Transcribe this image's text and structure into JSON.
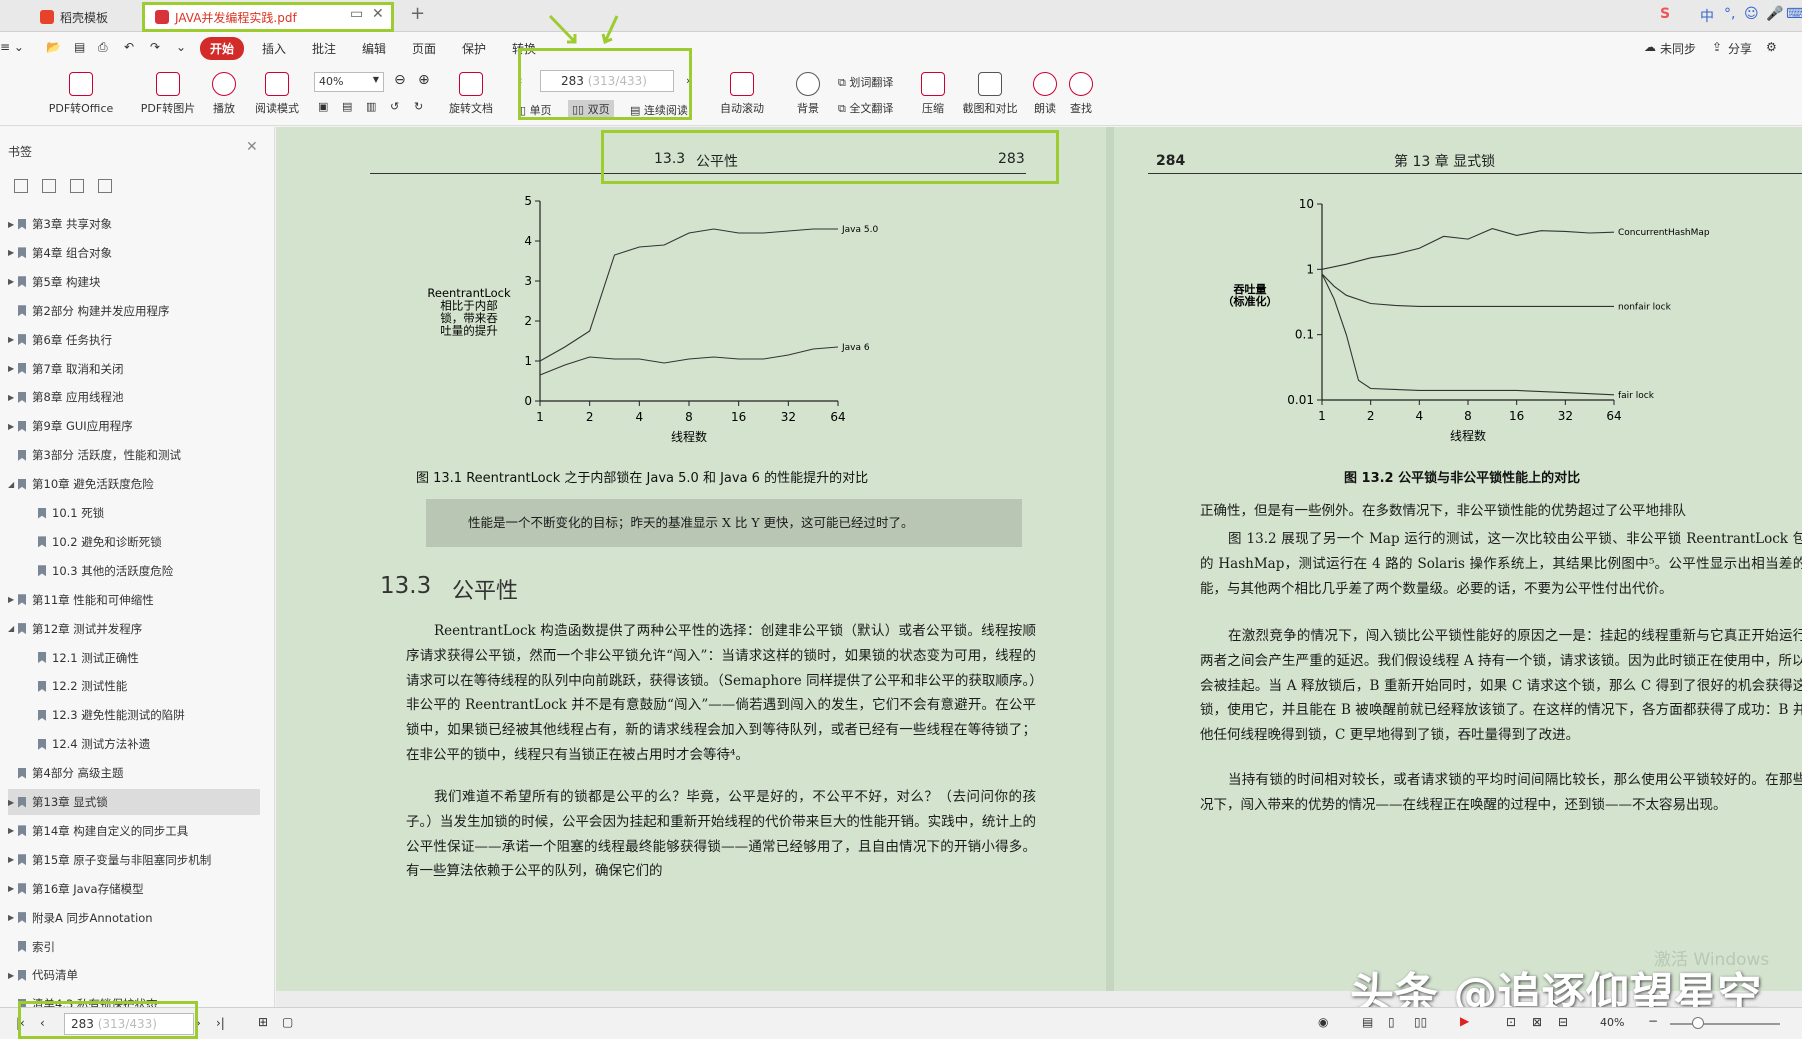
{
  "tabs": [
    {
      "label": "稻壳模板"
    },
    {
      "label": "JAVA并发编程实践.pdf"
    }
  ],
  "menu": [
    "开始",
    "插入",
    "批注",
    "编辑",
    "页面",
    "保护",
    "转换"
  ],
  "topright": {
    "sync": "未同步",
    "share": "分享"
  },
  "ribbon": {
    "pdf_office": "PDF转Office",
    "pdf_image": "PDF转图片",
    "play": "播放",
    "read_mode": "阅读模式",
    "zoom": "40%",
    "rotate": "旋转文档",
    "page_current": "283",
    "page_total": "(313/433)",
    "single": "单页",
    "double": "双页",
    "continuous": "连续阅读",
    "autoscroll": "自动滚动",
    "background": "背景",
    "word_translate": "划词翻译",
    "full_translate": "全文翻译",
    "compress": "压缩",
    "screenshot": "截图和对比",
    "read_aloud": "朗读",
    "find": "查找"
  },
  "sidebar": {
    "title": "书签",
    "items": [
      {
        "label": "第3章  共享对象",
        "level": 0,
        "arrow": "▶"
      },
      {
        "label": "第4章  组合对象",
        "level": 0,
        "arrow": "▶"
      },
      {
        "label": "第5章  构建块",
        "level": 0,
        "arrow": "▶"
      },
      {
        "label": "第2部分  构建并发应用程序",
        "level": 0,
        "arrow": ""
      },
      {
        "label": "第6章  任务执行",
        "level": 0,
        "arrow": "▶"
      },
      {
        "label": "第7章  取消和关闭",
        "level": 0,
        "arrow": "▶"
      },
      {
        "label": "第8章  应用线程池",
        "level": 0,
        "arrow": "▶"
      },
      {
        "label": "第9章  GUI应用程序",
        "level": 0,
        "arrow": "▶"
      },
      {
        "label": "第3部分  活跃度，性能和测试",
        "level": 0,
        "arrow": ""
      },
      {
        "label": "第10章  避免活跃度危险",
        "level": 0,
        "arrow": "◢"
      },
      {
        "label": "10.1  死锁",
        "level": 1,
        "arrow": ""
      },
      {
        "label": "10.2  避免和诊断死锁",
        "level": 1,
        "arrow": ""
      },
      {
        "label": "10.3  其他的活跃度危险",
        "level": 1,
        "arrow": ""
      },
      {
        "label": "第11章  性能和可伸缩性",
        "level": 0,
        "arrow": "▶"
      },
      {
        "label": "第12章  测试并发程序",
        "level": 0,
        "arrow": "◢"
      },
      {
        "label": "12.1  测试正确性",
        "level": 1,
        "arrow": ""
      },
      {
        "label": "12.2  测试性能",
        "level": 1,
        "arrow": ""
      },
      {
        "label": "12.3  避免性能测试的陷阱",
        "level": 1,
        "arrow": ""
      },
      {
        "label": "12.4  测试方法补遗",
        "level": 1,
        "arrow": ""
      },
      {
        "label": "第4部分  高级主题",
        "level": 0,
        "arrow": ""
      },
      {
        "label": "第13章  显式锁",
        "level": 0,
        "arrow": "▶",
        "selected": true
      },
      {
        "label": "第14章  构建自定义的同步工具",
        "level": 0,
        "arrow": "▶"
      },
      {
        "label": "第15章  原子变量与非阻塞同步机制",
        "level": 0,
        "arrow": "▶"
      },
      {
        "label": "第16章  Java存储模型",
        "level": 0,
        "arrow": "▶"
      },
      {
        "label": "附录A  同步Annotation",
        "level": 0,
        "arrow": "▶"
      },
      {
        "label": "索引",
        "level": 0,
        "arrow": ""
      },
      {
        "label": "代码清单",
        "level": 0,
        "arrow": "▶"
      },
      {
        "label": "清单4.3  私有锁保护状态",
        "level": 0,
        "arrow": ""
      }
    ]
  },
  "left_page": {
    "section_no": "13.3",
    "section_name": "公平性",
    "page_no": "283",
    "figure_caption": "图 13.1   ReentrantLock 之于内部锁在 Java 5.0 和 Java 6 的性能提升的对比",
    "note": "性能是一个不断变化的目标；昨天的基准显示 X 比 Y 更快，这可能已经过时了。",
    "heading_no": "13.3",
    "heading": "公平性",
    "paragraphs": [
      "ReentrantLock 构造函数提供了两种公平性的选择：创建非公平锁（默认）或者公平锁。线程按顺序请求获得公平锁，然而一个非公平锁允许“闯入”：当请求这样的锁时，如果锁的状态变为可用，线程的请求可以在等待线程的队列中向前跳跃，获得该锁。（Semaphore 同样提供了公平和非公平的获取顺序。）非公平的 ReentrantLock 并不是有意鼓励“闯入”——倘若遇到闯入的发生，它们不会有意避开。在公平锁中，如果锁已经被其他线程占有，新的请求线程会加入到等待队列，或者已经有一些线程在等待锁了；在非公平的锁中，线程只有当锁正在被占用时才会等待⁴。",
      "我们难道不希望所有的锁都是公平的么？毕竟，公平是好的，不公平不好，对么？（去问问你的孩子。）当发生加锁的时候，公平会因为挂起和重新开始线程的代价带来巨大的性能开销。实践中，统计上的公平性保证——承诺一个阻塞的线程最终能够获得锁——通常已经够用了，且自由情况下的开销小得多。有一些算法依赖于公平的队列，确保它们的"
    ]
  },
  "right_page": {
    "page_no": "284",
    "chapter": "第 13 章   显式锁",
    "figure_caption": "图 13.2   公平锁与非公平锁性能上的对比",
    "paragraphs": [
      "正确性，但是有一些例外。在多数情况下，非公平锁性能的优势超过了公平地排队",
      "图 13.2 展现了另一个 Map 运行的测试，这一次比较由公平锁、非公平锁 ReentrantLock 包装的 HashMap，测试运行在 4 路的 Solaris 操作系统上，其结果比例图中⁵。公平性显示出相当差的性能，与其他两个相比几乎差了两个数量级。必要的话，不要为公平性付出代价。",
      "在激烈竞争的情况下，闯入锁比公平锁性能好的原因之一是：挂起的线程重新与它真正开始运行，两者之间会产生严重的延迟。我们假设线程 A 持有一个锁，请求该锁。因为此时锁正在使用中，所以 B 会被挂起。当 A 释放锁后，B 重新开始同时，如果 C 请求这个锁，那么 C 得到了很好的机会获得这个锁，使用它，并且能在 B 被唤醒前就已经释放该锁了。在这样的情况下，各方面都获得了成功：B 并其他任何线程晚得到锁，C 更早地得到了锁，吞吐量得到了改进。",
      "当持有锁的时间相对较长，或者请求锁的平均时间间隔比较长，那么使用公平锁较好的。在那些情况下，闯入带来的优势的情况——在线程正在唤醒的过程中，还到锁——不太容易出现。"
    ]
  },
  "status": {
    "page_current": "283",
    "page_total": "(313/433)",
    "zoom": "40%"
  },
  "watermark": "头条 @追逐仰望星空",
  "activate": "激活 Windows",
  "chart_data": [
    {
      "type": "line",
      "ylabel": "ReentrantLock 相比于内部锁，带来吞吐量的提升",
      "xlabel": "线程数",
      "categories": [
        "1",
        "2",
        "4",
        "8",
        "16",
        "32",
        "64"
      ],
      "ylim": [
        0,
        5
      ],
      "yticks": [
        "0",
        "1",
        "2",
        "3",
        "4",
        "5"
      ],
      "series": [
        {
          "name": "Java 5.0",
          "x": [
            1,
            1.5,
            2,
            2.5,
            3,
            3.5,
            4,
            4.5,
            5,
            5.5,
            6,
            6.5,
            7
          ],
          "values": [
            1.0,
            1.35,
            1.75,
            3.65,
            3.85,
            3.9,
            4.2,
            4.3,
            4.2,
            4.2,
            4.25,
            4.3,
            4.3
          ]
        },
        {
          "name": "Java 6",
          "x": [
            1,
            1.5,
            2,
            2.5,
            3,
            3.5,
            4,
            4.5,
            5,
            5.5,
            6,
            6.5,
            7
          ],
          "values": [
            0.65,
            0.9,
            1.1,
            1.05,
            1.05,
            0.95,
            1.05,
            1.1,
            1.05,
            1.05,
            1.15,
            1.3,
            1.35
          ]
        }
      ]
    },
    {
      "type": "line",
      "ylabel": "吞吐量（标准化）",
      "xlabel": "线程数",
      "categories": [
        "1",
        "2",
        "4",
        "8",
        "16",
        "32",
        "64"
      ],
      "ylim": [
        0.01,
        10
      ],
      "yticks": [
        "0.01",
        "0.1",
        "1",
        "10"
      ],
      "series": [
        {
          "name": "ConcurrentHashMap",
          "x": [
            1,
            1.5,
            2,
            2.5,
            3,
            3.5,
            4,
            4.5,
            5,
            5.5,
            6,
            6.5,
            7
          ],
          "values": [
            1.0,
            1.2,
            1.5,
            1.7,
            2.1,
            3.2,
            2.9,
            4.2,
            3.3,
            3.9,
            3.8,
            3.6,
            3.7
          ]
        },
        {
          "name": "nonfair lock",
          "x": [
            1,
            1.25,
            1.5,
            2,
            2.5,
            3,
            4,
            5,
            6,
            7
          ],
          "values": [
            0.85,
            0.55,
            0.4,
            0.3,
            0.28,
            0.27,
            0.27,
            0.27,
            0.27,
            0.27
          ]
        },
        {
          "name": "fair lock",
          "x": [
            1,
            1.25,
            1.5,
            1.75,
            2,
            3,
            4,
            5,
            6,
            7
          ],
          "values": [
            0.85,
            0.35,
            0.1,
            0.02,
            0.015,
            0.014,
            0.014,
            0.014,
            0.013,
            0.012
          ]
        }
      ]
    }
  ]
}
